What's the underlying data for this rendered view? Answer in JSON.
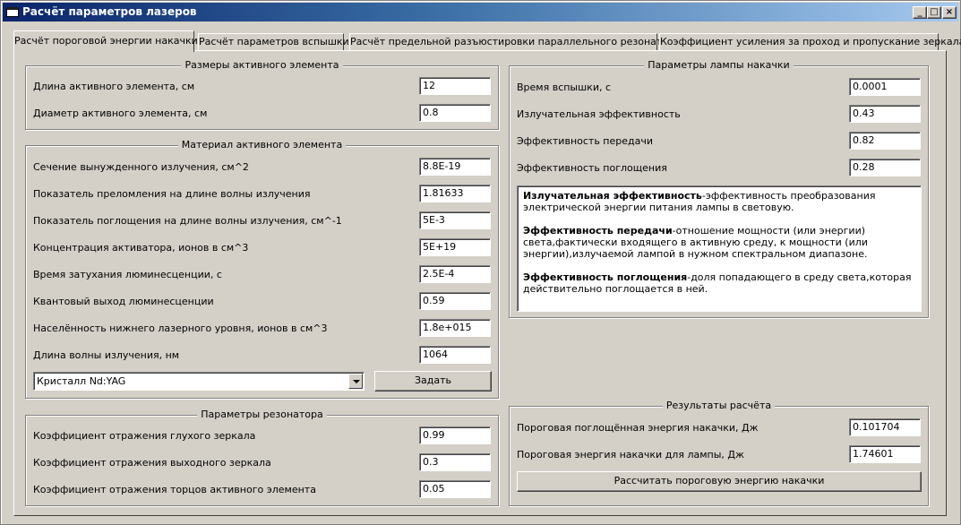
{
  "window": {
    "title": "Расчёт параметров лазеров",
    "minimize_glyph": "_",
    "maximize_glyph": "□",
    "close_glyph": "×"
  },
  "tabs": [
    {
      "label": "Расчёт пороговой энергии накачки"
    },
    {
      "label": "Расчёт параметров вспышки"
    },
    {
      "label": "Расчёт предельной разъюстировки параллельного резонатора"
    },
    {
      "label": "Коэффициент усиления за проход и пропускание зеркала"
    }
  ],
  "dimensions": {
    "title": "Размеры активного элемента",
    "rows": [
      {
        "label": "Длина активного элемента, см",
        "value": "12"
      },
      {
        "label": "Диаметр активного элемента, см",
        "value": "0.8"
      }
    ]
  },
  "material": {
    "title": "Материал активного элемента",
    "rows": [
      {
        "label": "Сечение вынужденного излучения, см^2",
        "value": "8.8E-19"
      },
      {
        "label": "Показатель преломления на длине волны излучения",
        "value": "1.81633"
      },
      {
        "label": "Показатель поглощения на длине волны излучения, см^-1",
        "value": "5E-3"
      },
      {
        "label": "Концентрация активатора, ионов в см^3",
        "value": "5E+19"
      },
      {
        "label": "Время затухания люминесценции, с",
        "value": "2.5E-4"
      },
      {
        "label": "Квантовый выход люминесценции",
        "value": "0.59"
      },
      {
        "label": "Населённость нижнего лазерного уровня, ионов в см^3",
        "value": "1.8e+015"
      },
      {
        "label": "Длина волны излучения, нм",
        "value": "1064"
      }
    ],
    "crystal_select": "Кристалл Nd:YAG",
    "set_button": "Задать"
  },
  "resonator": {
    "title": "Параметры резонатора",
    "rows": [
      {
        "label": "Коэффициент отражения глухого зеркала",
        "value": "0.99"
      },
      {
        "label": "Коэффициент отражения выходного зеркала",
        "value": "0.3"
      },
      {
        "label": "Коэффициент отражения торцов активного элемента",
        "value": "0.05"
      }
    ]
  },
  "lamp": {
    "title": "Параметры лампы накачки",
    "rows": [
      {
        "label": "Время вспышки, с",
        "value": "0.0001"
      },
      {
        "label": "Излучательная эффективность",
        "value": "0.43"
      },
      {
        "label": "Эффективность передачи",
        "value": "0.82"
      },
      {
        "label": "Эффективность поглощения",
        "value": "0.28"
      }
    ],
    "help": [
      {
        "term": "Излучательная эффективность",
        "text": "-эффективность преобразования электрической энергии питания лампы в световую."
      },
      {
        "term": "Эффективность передачи",
        "text": "-отношение мощности (или энергии) света,фактически входящего в активную среду, к мощности (или энергии),излучаемой лампой в нужном спектральном диапазоне."
      },
      {
        "term": "Эффективность поглощения",
        "text": "-доля попадающего в среду света,которая действительно поглощается в ней."
      }
    ]
  },
  "results": {
    "title": "Результаты расчёта",
    "rows": [
      {
        "label": "Пороговая поглощённая энергия накачки, Дж",
        "value": "0.101704"
      },
      {
        "label": "Пороговая энергия накачки для лампы, Дж",
        "value": "1.74601"
      }
    ],
    "calc_button": "Рассчитать пороговую энергию накачки"
  }
}
